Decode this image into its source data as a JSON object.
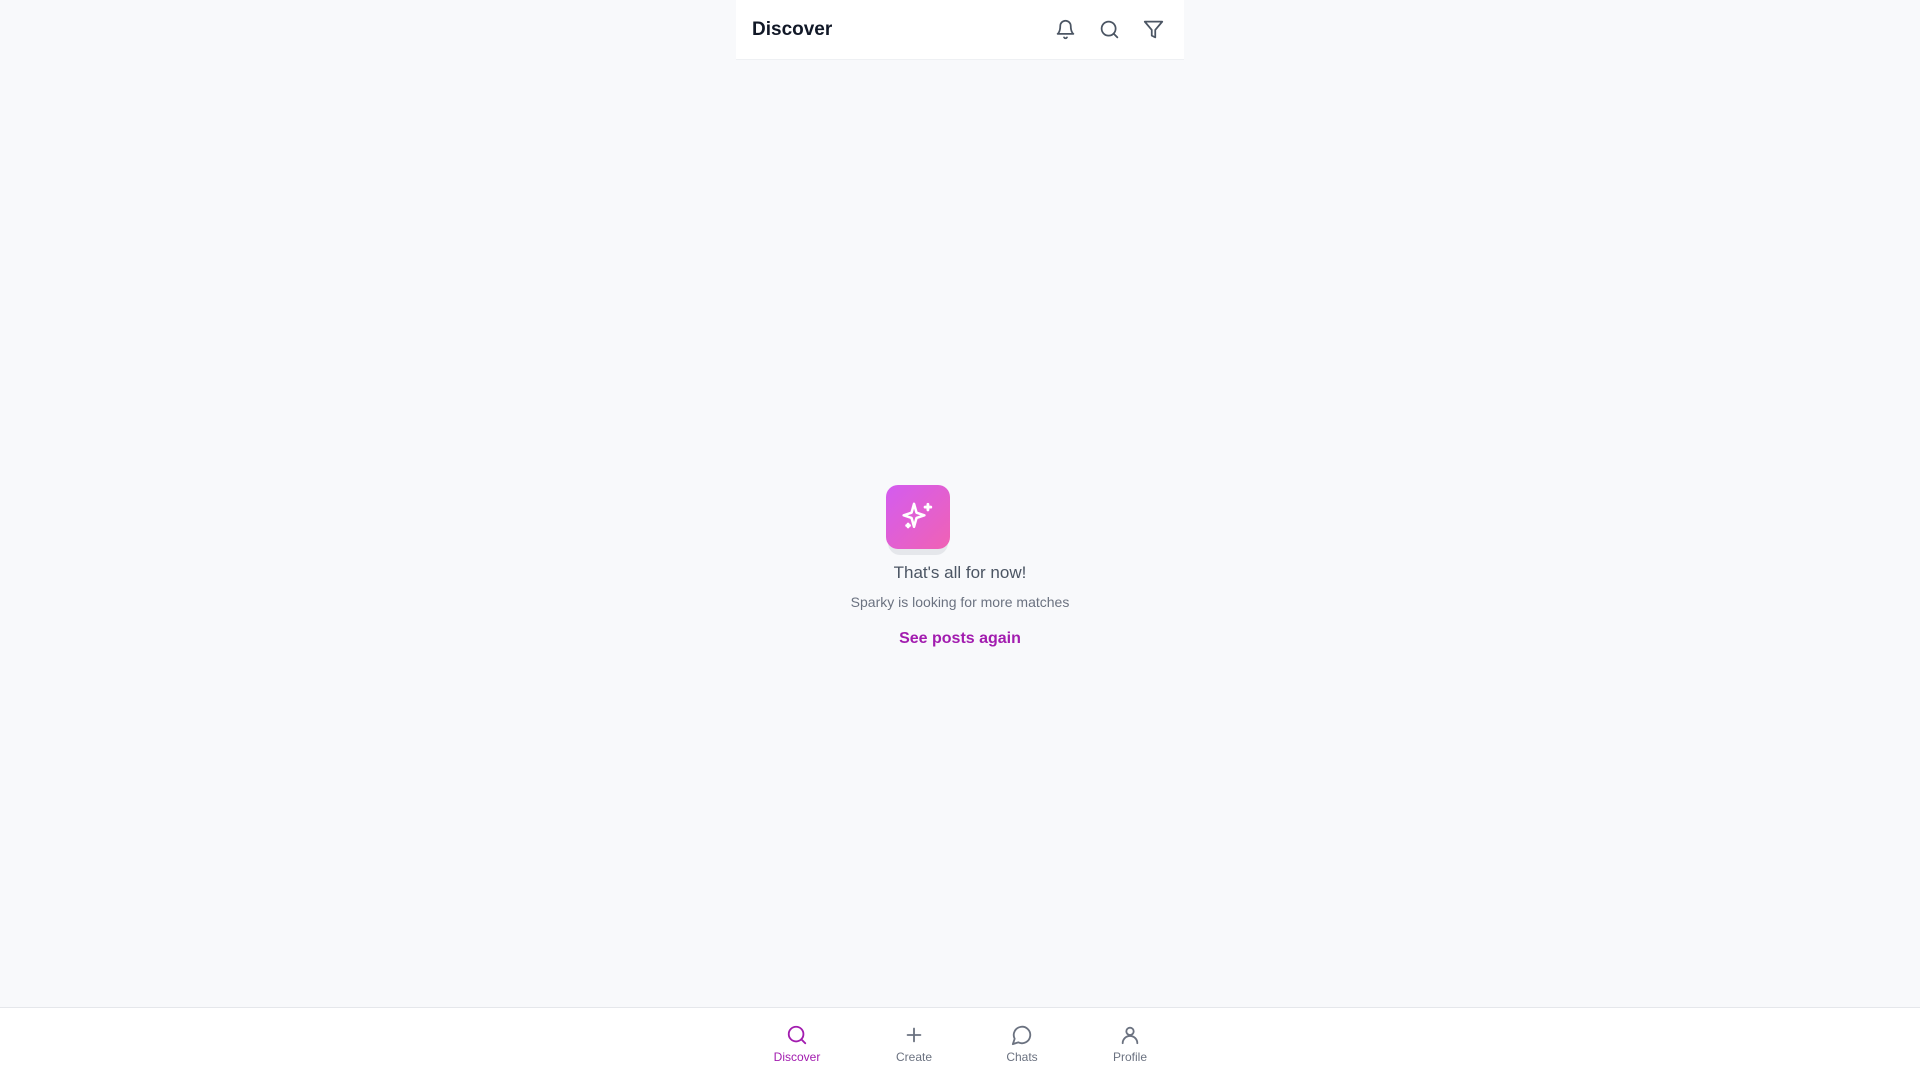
{
  "header": {
    "title": "Discover",
    "icons": [
      "bell-icon",
      "search-icon",
      "filter-icon"
    ]
  },
  "empty_state": {
    "icon": "sparkles-icon",
    "title": "That's all for now!",
    "subtitle": "Sparky is looking for more matches",
    "link_label": "See posts again"
  },
  "bottom_nav": {
    "items": [
      {
        "label": "Discover",
        "icon": "search-icon",
        "active": true
      },
      {
        "label": "Create",
        "icon": "plus-icon",
        "active": false
      },
      {
        "label": "Chats",
        "icon": "chat-icon",
        "active": false
      },
      {
        "label": "Profile",
        "icon": "user-icon",
        "active": false
      }
    ]
  },
  "colors": {
    "accent": "#a21caf",
    "badge_gradient_start": "#d35cf0",
    "badge_gradient_end": "#f062b4",
    "background": "#f8f9fb"
  }
}
